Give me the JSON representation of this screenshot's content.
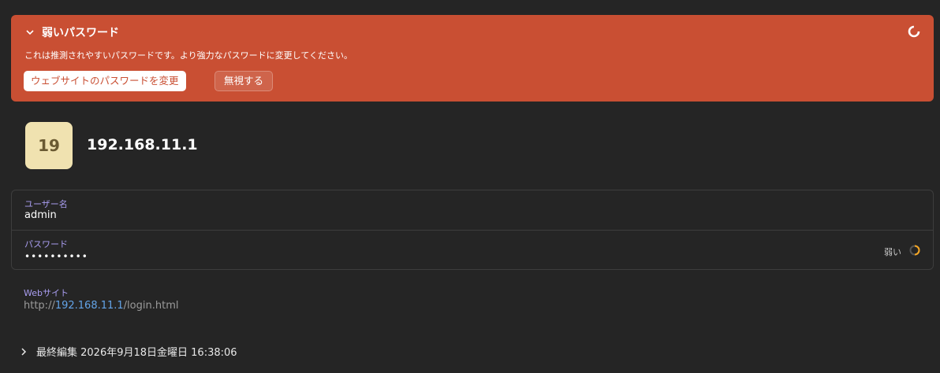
{
  "alert": {
    "title": "弱いパスワード",
    "message": "これは推測されやすいパスワードです。より強力なパスワードに変更してください。",
    "change_button": "ウェブサイトのパスワードを変更",
    "ignore_button": "無視する",
    "bg_color": "#c94f33"
  },
  "item": {
    "badge": "19",
    "title": "192.168.11.1"
  },
  "fields": {
    "username_label": "ユーザー名",
    "username_value": "admin",
    "password_label": "パスワード",
    "password_value": "••••••••••",
    "strength_label": "弱い"
  },
  "website": {
    "label": "Webサイト",
    "url_prefix": "http://",
    "url_host": "192.168.11.1",
    "url_path": "/login.html"
  },
  "history": {
    "last_edited": "最終編集 2026年9月18日金曜日 16:38:06"
  },
  "icons": {
    "collapse": "chevron-down-icon",
    "progress": "progress-ring-icon",
    "expand": "chevron-right-icon"
  }
}
